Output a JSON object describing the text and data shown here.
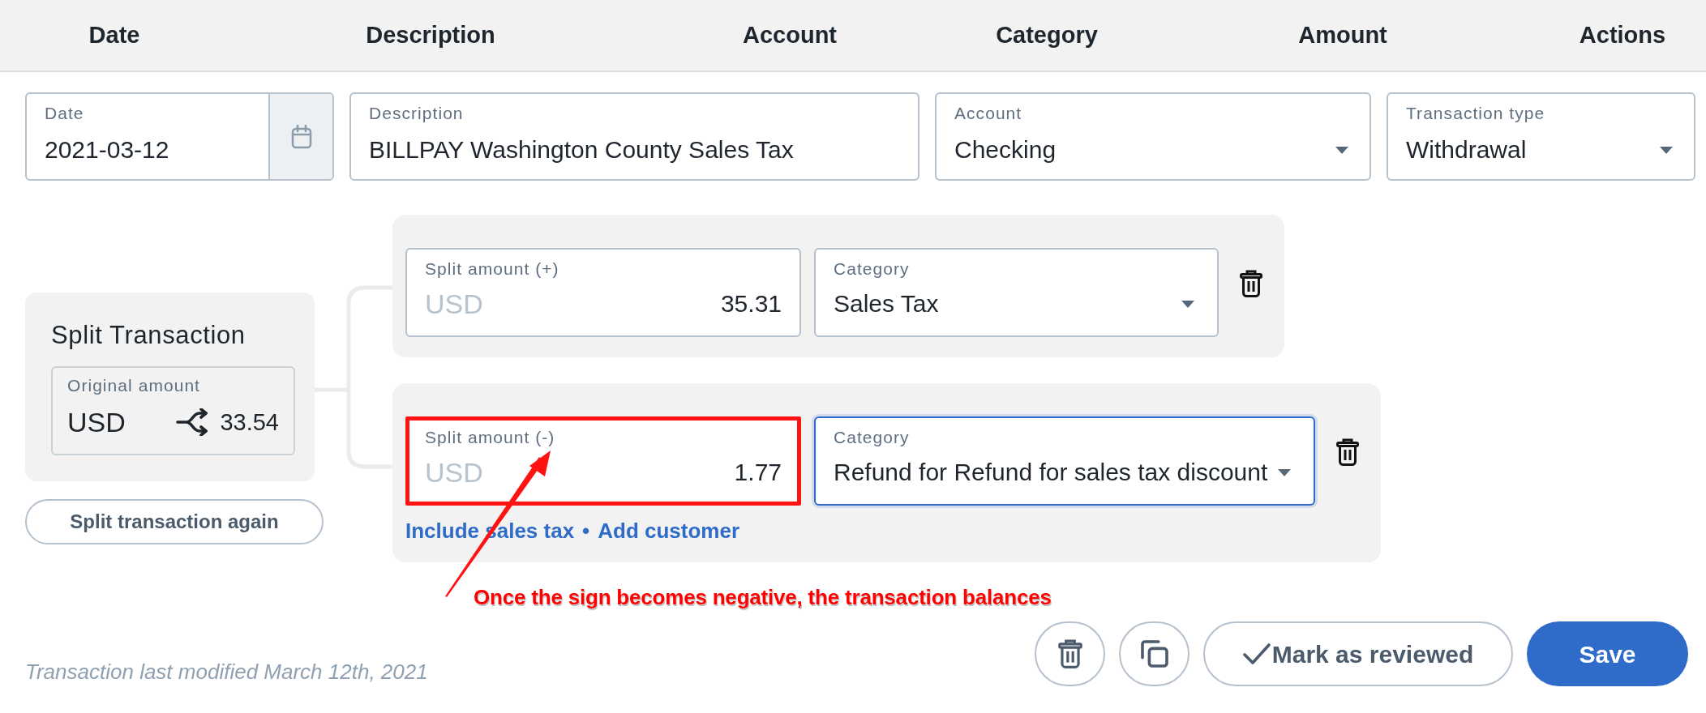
{
  "table_header": {
    "columns": [
      "Date",
      "Description",
      "Account",
      "Category",
      "Amount",
      "Actions"
    ]
  },
  "fields": [
    {
      "kind": "date",
      "label": "Date",
      "value": "2021-03-12"
    },
    {
      "kind": "text",
      "label": "Description",
      "value": "BILLPAY Washington County Sales Tax"
    },
    {
      "kind": "select",
      "label": "Account",
      "value": "Checking"
    },
    {
      "kind": "select",
      "label": "Transaction type",
      "value": "Withdrawal"
    }
  ],
  "split_summary": {
    "title": "Split Transaction",
    "original_amount": {
      "label": "Original amount",
      "currency": "USD",
      "value": "33.54"
    },
    "again_button": "Split transaction again"
  },
  "splits": [
    {
      "amount_label": "Split amount (+)",
      "currency": "USD",
      "amount": "35.31",
      "highlighted": false,
      "category_label": "Category",
      "category": "Sales Tax",
      "focused": false
    },
    {
      "amount_label": "Split amount (-)",
      "currency": "USD",
      "amount": "1.77",
      "highlighted": true,
      "category_label": "Category",
      "category": "Refund for Refund for sales tax discount",
      "focused": true,
      "links": [
        "Include sales tax",
        "Add customer"
      ],
      "link_separator": "•"
    }
  ],
  "annotation": {
    "text": "Once the sign becomes negative, the transaction balances"
  },
  "footer": {
    "modified": "Transaction last modified March 12th, 2021",
    "buttons": [
      {
        "kind": "delete"
      },
      {
        "kind": "copy"
      },
      {
        "kind": "review",
        "label": "Mark as reviewed"
      },
      {
        "kind": "save",
        "label": "Save"
      }
    ]
  }
}
